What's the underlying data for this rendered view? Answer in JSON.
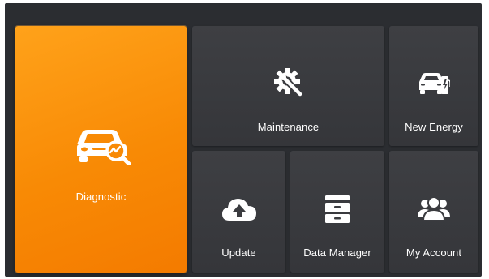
{
  "tiles": {
    "diagnostic": {
      "label": "Diagnostic",
      "icon": "car-diagnostic-icon"
    },
    "maintenance": {
      "label": "Maintenance",
      "icon": "wrench-gear-icon"
    },
    "new_energy": {
      "label": "New Energy",
      "icon": "ev-charging-icon"
    },
    "update": {
      "label": "Update",
      "icon": "cloud-upload-icon"
    },
    "data_manager": {
      "label": "Data Manager",
      "icon": "filing-cabinet-icon"
    },
    "my_account": {
      "label": "My Account",
      "icon": "users-icon"
    }
  },
  "colors": {
    "accent": "#f88a05",
    "tile": "#3a3b3f",
    "background": "#2b2d31",
    "text": "#ffffff"
  }
}
